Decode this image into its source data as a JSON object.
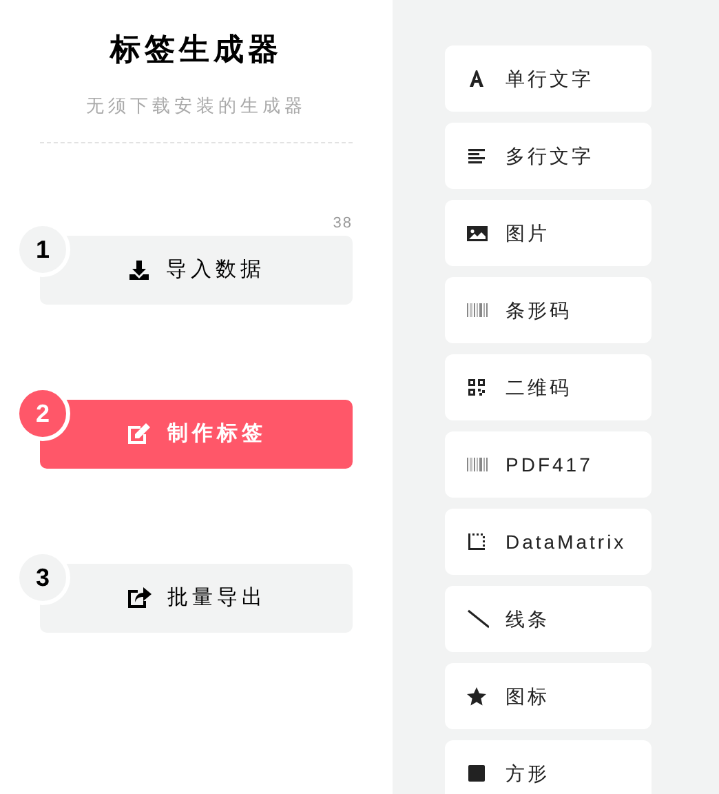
{
  "header": {
    "title": "标签生成器",
    "subtitle": "无须下载安装的生成器"
  },
  "steps": [
    {
      "number": "1",
      "label": "导入数据",
      "kind": "download",
      "selected": false,
      "count": "38"
    },
    {
      "number": "2",
      "label": "制作标签",
      "kind": "edit",
      "selected": true
    },
    {
      "number": "3",
      "label": "批量导出",
      "kind": "export",
      "selected": false
    }
  ],
  "tools": [
    {
      "kind": "text",
      "label": "单行文字"
    },
    {
      "kind": "paragraph",
      "label": "多行文字"
    },
    {
      "kind": "image",
      "label": "图片"
    },
    {
      "kind": "barcode",
      "label": "条形码"
    },
    {
      "kind": "qrcode",
      "label": "二维码"
    },
    {
      "kind": "pdf417",
      "label": "PDF417"
    },
    {
      "kind": "datamatrix",
      "label": "DataMatrix"
    },
    {
      "kind": "line",
      "label": "线条"
    },
    {
      "kind": "star",
      "label": "图标"
    },
    {
      "kind": "rect",
      "label": "方形"
    }
  ]
}
